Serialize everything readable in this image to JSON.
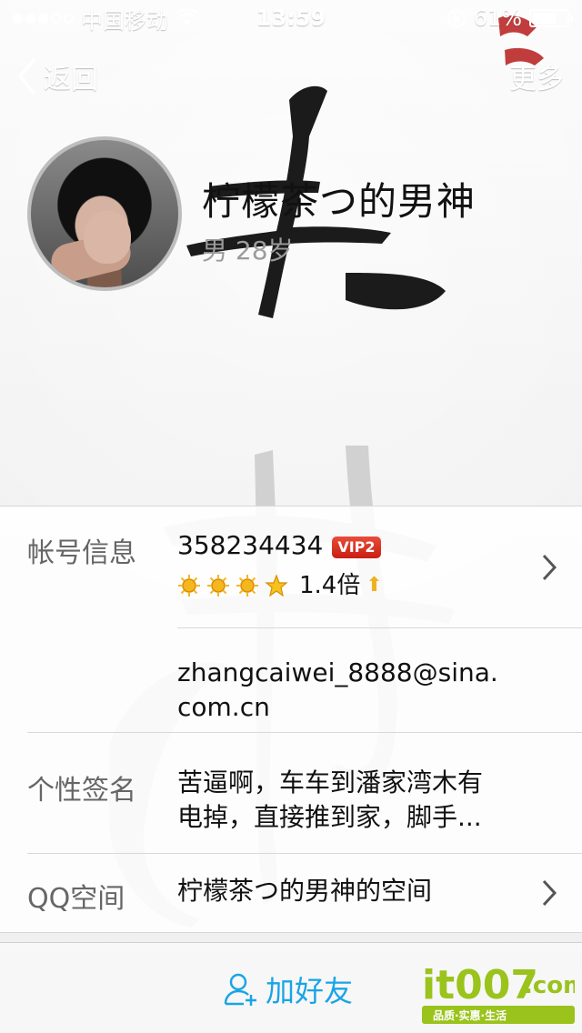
{
  "status_bar": {
    "carrier": "中国移动",
    "time": "13:59",
    "battery": "61%",
    "signal_bars_filled": 3,
    "signal_bars_total": 5
  },
  "nav": {
    "back_label": "返回",
    "more_label": "更多"
  },
  "profile": {
    "name": "柠檬茶つ的男神",
    "sub_info": "男 28岁"
  },
  "rows": {
    "account": {
      "label": "帐号信息",
      "qq_number": "358234434",
      "vip_badge": "VIP2",
      "level_multiplier": "1.4倍"
    },
    "email": {
      "value": "zhangcaiwei_8888@sina.\ncom.cn"
    },
    "signature": {
      "label": "个性签名",
      "value": "苦逼啊，车车到潘家湾木有\n电掉，直接推到家，脚手..."
    },
    "qzone": {
      "label": "QQ空间",
      "value": "柠檬茶つ的男神的空间"
    }
  },
  "toolbar": {
    "add_friend_label": "加好友"
  },
  "watermark": {
    "brand": "it007",
    "suffix": ".com",
    "tagline": "品质·实惠·生活"
  },
  "colors": {
    "accent_blue": "#1aa4e6",
    "vip_red": "#d8291a",
    "watermark_green": "#9ac31c"
  }
}
